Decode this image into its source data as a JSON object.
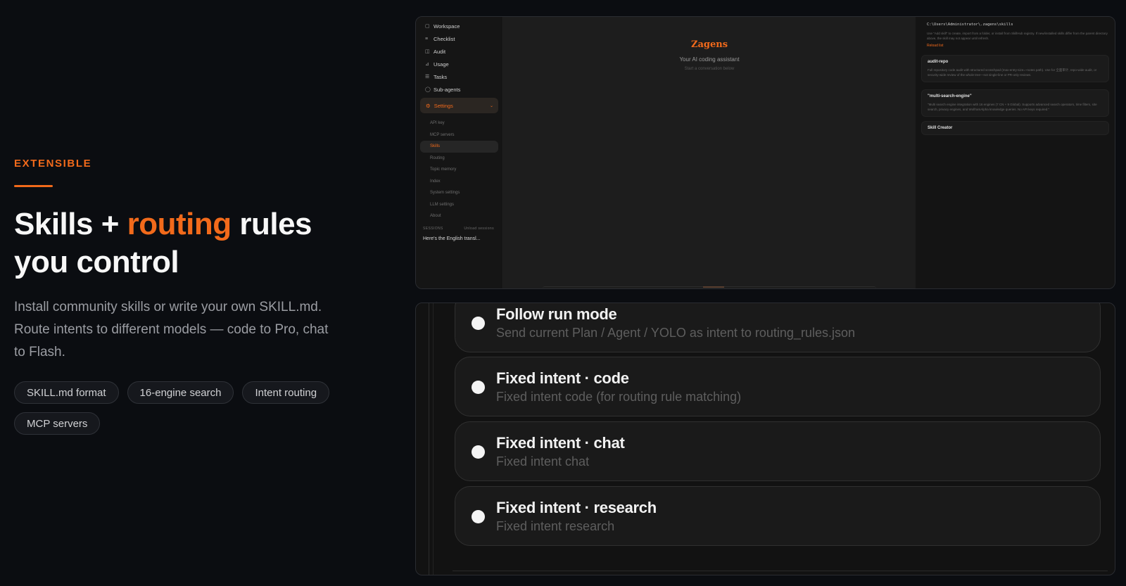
{
  "hero": {
    "eyebrow": "EXTENSIBLE",
    "headline_part1": "Skills + ",
    "headline_accent": "routing",
    "headline_part2": " rules you control",
    "lede": "Install community skills or write your own SKILL.md. Route intents to different models — code to Pro, chat to Flash.",
    "chips": [
      "SKILL.md format",
      "16-engine search",
      "Intent routing",
      "MCP servers"
    ]
  },
  "app": {
    "sidebar": {
      "items": [
        {
          "label": "Workspace",
          "icon": "folder-icon"
        },
        {
          "label": "Checklist",
          "icon": "list-icon"
        },
        {
          "label": "Audit",
          "icon": "audit-icon"
        },
        {
          "label": "Usage",
          "icon": "chart-icon"
        },
        {
          "label": "Tasks",
          "icon": "tasks-icon"
        },
        {
          "label": "Sub-agents",
          "icon": "agent-icon"
        }
      ],
      "settings_label": "Settings",
      "sub_items": [
        "API key",
        "MCP servers",
        "Skills",
        "Routing",
        "Topic memory",
        "Index",
        "System settings",
        "LLM settings",
        "About"
      ],
      "active_sub": "Skills",
      "sessions_label": "SESSIONS",
      "sessions_action": "Unload sessions",
      "session_item": "Here's the English transl..."
    },
    "main": {
      "brand": "Zagens",
      "tagline": "Your AI coding assistant",
      "subtitle": "Start a conversation below"
    },
    "skills_panel": {
      "path": "C:\\Users\\Administrator\\.zagens\\skills",
      "hint": "Use \"Add skill\" to create, import from a folder, or install from SkillHub registry. If new/installed skills differ from the parent directory above, the skill may not appear until refresh.",
      "link": "Reload list",
      "skills": [
        {
          "name": "audit-repo",
          "desc": "Full repository code audit with structured scratchpad (max-entry-size=~notes path). Use for 全面审计, repo-wide audit, or security-wide review of the whole tree—not single-line or PR-only reviews."
        },
        {
          "name": "\"multi-search-engine\"",
          "desc": "\"Multi search engine integration with 16 engines (7 CN + 9 Global). Supports advanced search operators, time filters, site search, privacy engines, and WolframAlpha knowledge queries. No API keys required.\""
        },
        {
          "name": "Skill Creator",
          "desc": ""
        }
      ]
    }
  },
  "routing": {
    "options": [
      {
        "title": "Follow run mode",
        "desc": "Send current Plan / Agent / YOLO as intent to routing_rules.json"
      },
      {
        "title": "Fixed intent · code",
        "desc": "Fixed intent code (for routing rule matching)"
      },
      {
        "title": "Fixed intent · chat",
        "desc": "Fixed intent chat"
      },
      {
        "title": "Fixed intent · research",
        "desc": "Fixed intent research"
      }
    ]
  }
}
